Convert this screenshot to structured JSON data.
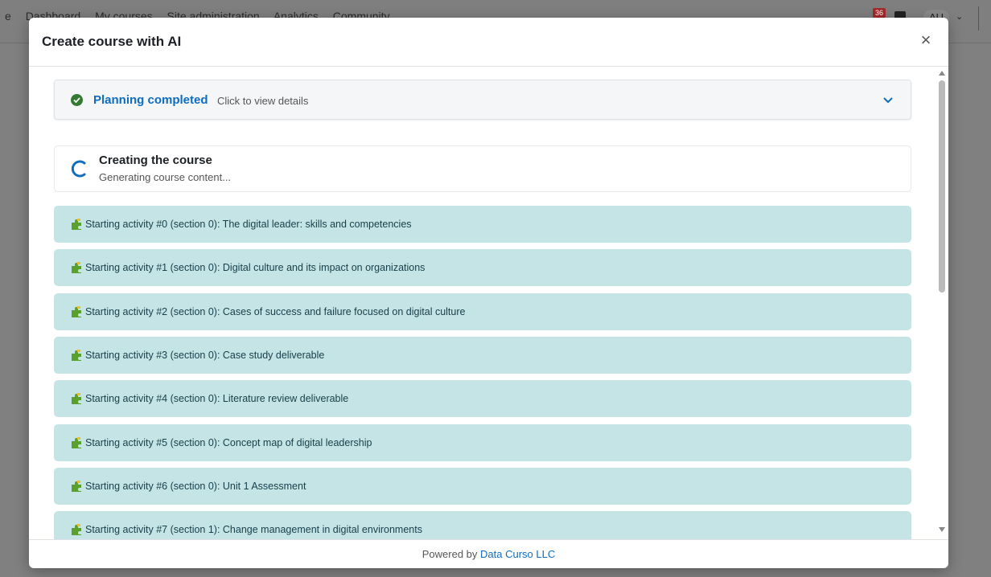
{
  "background": {
    "nav_items": [
      "e",
      "Dashboard",
      "My courses",
      "Site administration",
      "Analytics",
      "Community"
    ],
    "notification_count": "36",
    "user_initials": "AU"
  },
  "modal": {
    "title": "Create course with AI",
    "close_label": "×",
    "planning": {
      "title": "Planning completed",
      "hint": "Click to view details"
    },
    "status": {
      "title": "Creating the course",
      "subtitle": "Generating course content..."
    },
    "activities": [
      "Starting activity #0 (section 0): The digital leader: skills and competencies",
      "Starting activity #1 (section 0): Digital culture and its impact on organizations",
      "Starting activity #2 (section 0): Cases of success and failure focused on digital culture",
      "Starting activity #3 (section 0): Case study deliverable",
      "Starting activity #4 (section 0): Literature review deliverable",
      "Starting activity #5 (section 0): Concept map of digital leadership",
      "Starting activity #6 (section 0): Unit 1 Assessment",
      "Starting activity #7 (section 1): Change management in digital environments"
    ],
    "footer": {
      "prefix": "Powered by",
      "link": "Data Curso LLC"
    }
  },
  "colors": {
    "accent": "#0f6cbf",
    "success": "#357a32",
    "activity_bg": "#c5e4e5",
    "activity_text": "#163f4a"
  },
  "icons": {
    "planning": "check-circle-icon",
    "expand": "chevron-down-icon",
    "status": "spinner-icon",
    "activity": "puzzle-icon",
    "close": "close-icon"
  }
}
